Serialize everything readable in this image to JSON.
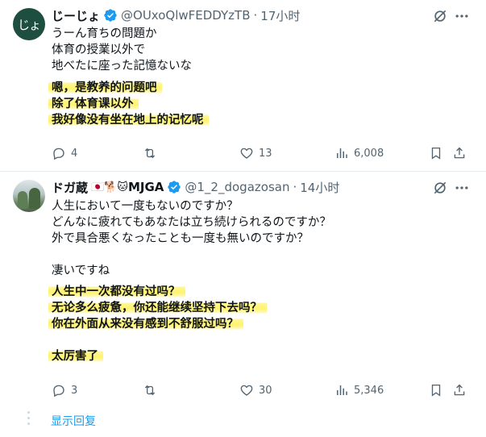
{
  "tweet1": {
    "avatar_text": "じょ",
    "name": "じーじょ",
    "handle": "@OUxoQlwFEDDYzTB",
    "separator": "·",
    "time": "17小时",
    "text_lines": [
      "うーん育ちの問題か",
      "体育の授業以外で",
      "地べたに座った記憶ないな"
    ],
    "highlight_lines": [
      "嗯，是教养的问题吧",
      "除了体育课以外",
      "我好像没有坐在地上的记忆呢"
    ],
    "replies": "4",
    "retweets": "",
    "likes": "13",
    "views": "6,008"
  },
  "tweet2": {
    "name": "ドガ蔵",
    "emoji": "🇯🇵🐕🐱",
    "name_suffix": "MJGA",
    "handle": "@1_2_dogazosan",
    "separator": "·",
    "time": "14小时",
    "text_lines": [
      "人生において一度もないのですか？",
      "どんなに疲れてもあなたは立ち続けられるのですか？",
      "外で具合悪くなったことも一度も無いのですか？",
      "",
      "凄いですね"
    ],
    "highlight_lines": [
      "人生中一次都没有过吗？",
      "无论多么疲惫，你还能继续坚持下去吗？",
      "你在外面从来没有感到不舒服过吗？",
      "",
      "太厉害了"
    ],
    "replies": "3",
    "retweets": "",
    "likes": "30",
    "views": "5,346"
  },
  "show_replies": "显示回复",
  "colors": {
    "accent": "#1d9bf0",
    "muted": "#536471",
    "highlight": "#fff36a"
  }
}
